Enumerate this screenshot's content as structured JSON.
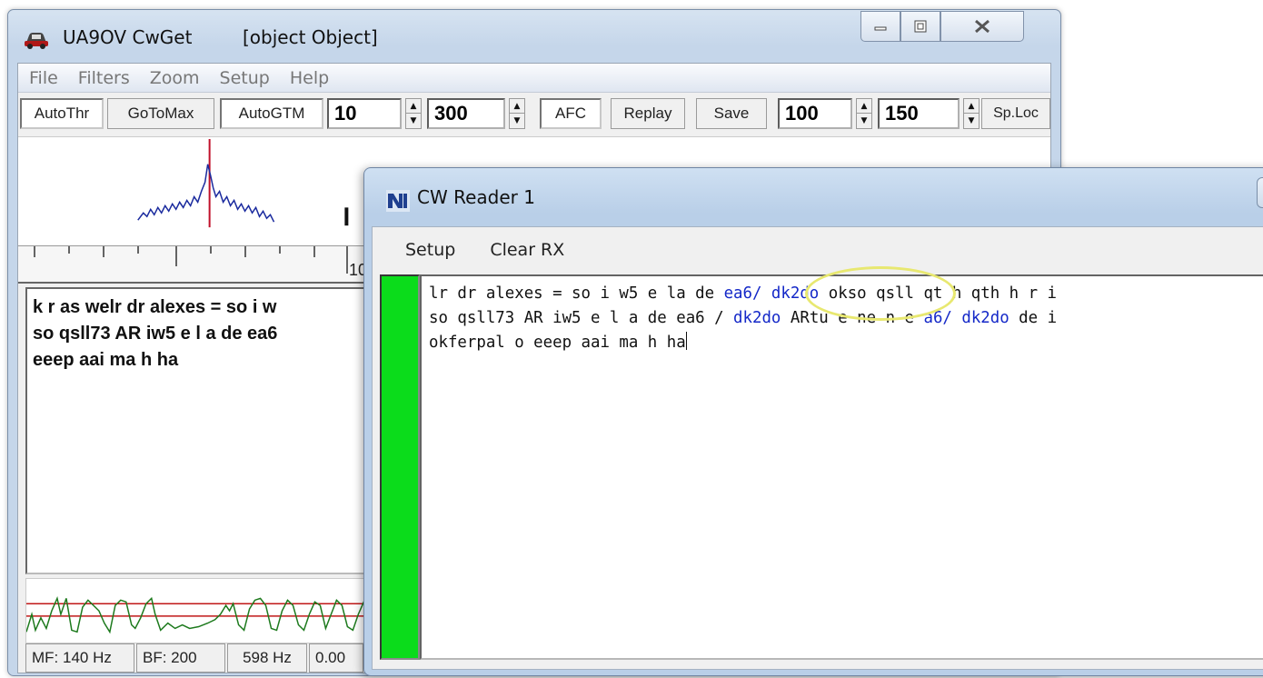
{
  "cwget": {
    "title": "UA9OV CwGet",
    "status": {
      "mf": "MF: 140 Hz",
      "bf": "BF: 200",
      "freq": "598 Hz",
      "level": "0.00"
    },
    "caption_buttons": {
      "minimize": "minimize-icon",
      "maximize": "maximize-icon",
      "close": "close-icon"
    },
    "menu": [
      "File",
      "Filters",
      "Zoom",
      "Setup",
      "Help"
    ],
    "toolbar": {
      "autothr": "AutoThr",
      "gotomax": "GoToMax",
      "autogtm": "AutoGTM",
      "value1": "10",
      "value2": "300",
      "afc": "AFC",
      "replay": "Replay",
      "save": "Save",
      "value3": "100",
      "value4": "150",
      "sploc": "Sp.Loc"
    },
    "ruler_label": "10",
    "rx_lines": [
      "k r as welr dr alexes = so i w",
      "so qsll73 AR iw5 e l a de ea6",
      "eeep aai ma h ha"
    ],
    "colors": {
      "spectrum": "#1a2a9e",
      "marker": "#c0102a",
      "scope_trace": "#1d7a1d",
      "scope_threshold": "#c01818"
    }
  },
  "reader": {
    "title": "CW Reader 1",
    "menu": [
      "Setup",
      "Clear RX"
    ],
    "lines": [
      [
        {
          "t": "lr dr alexes = so i w5 e la de ",
          "call": false
        },
        {
          "t": "ea6/ dk2do",
          "call": true
        },
        {
          "t": " okso qsll qt h qth h r i",
          "call": false
        }
      ],
      [
        {
          "t": "so qsll73 AR iw5 e l a de ea6 / ",
          "call": false
        },
        {
          "t": "dk2do",
          "call": true
        },
        {
          "t": " ARtu e ne n e ",
          "call": false
        },
        {
          "t": "a6/ dk2do",
          "call": true
        },
        {
          "t": " de i",
          "call": false
        }
      ],
      [
        {
          "t": "okferpal o eeep aai ma h ha",
          "call": false
        }
      ]
    ],
    "colors": {
      "tuning_bar": "#0bdc1b",
      "callsign": "#1428c8",
      "highlight": "#e8e870"
    }
  }
}
